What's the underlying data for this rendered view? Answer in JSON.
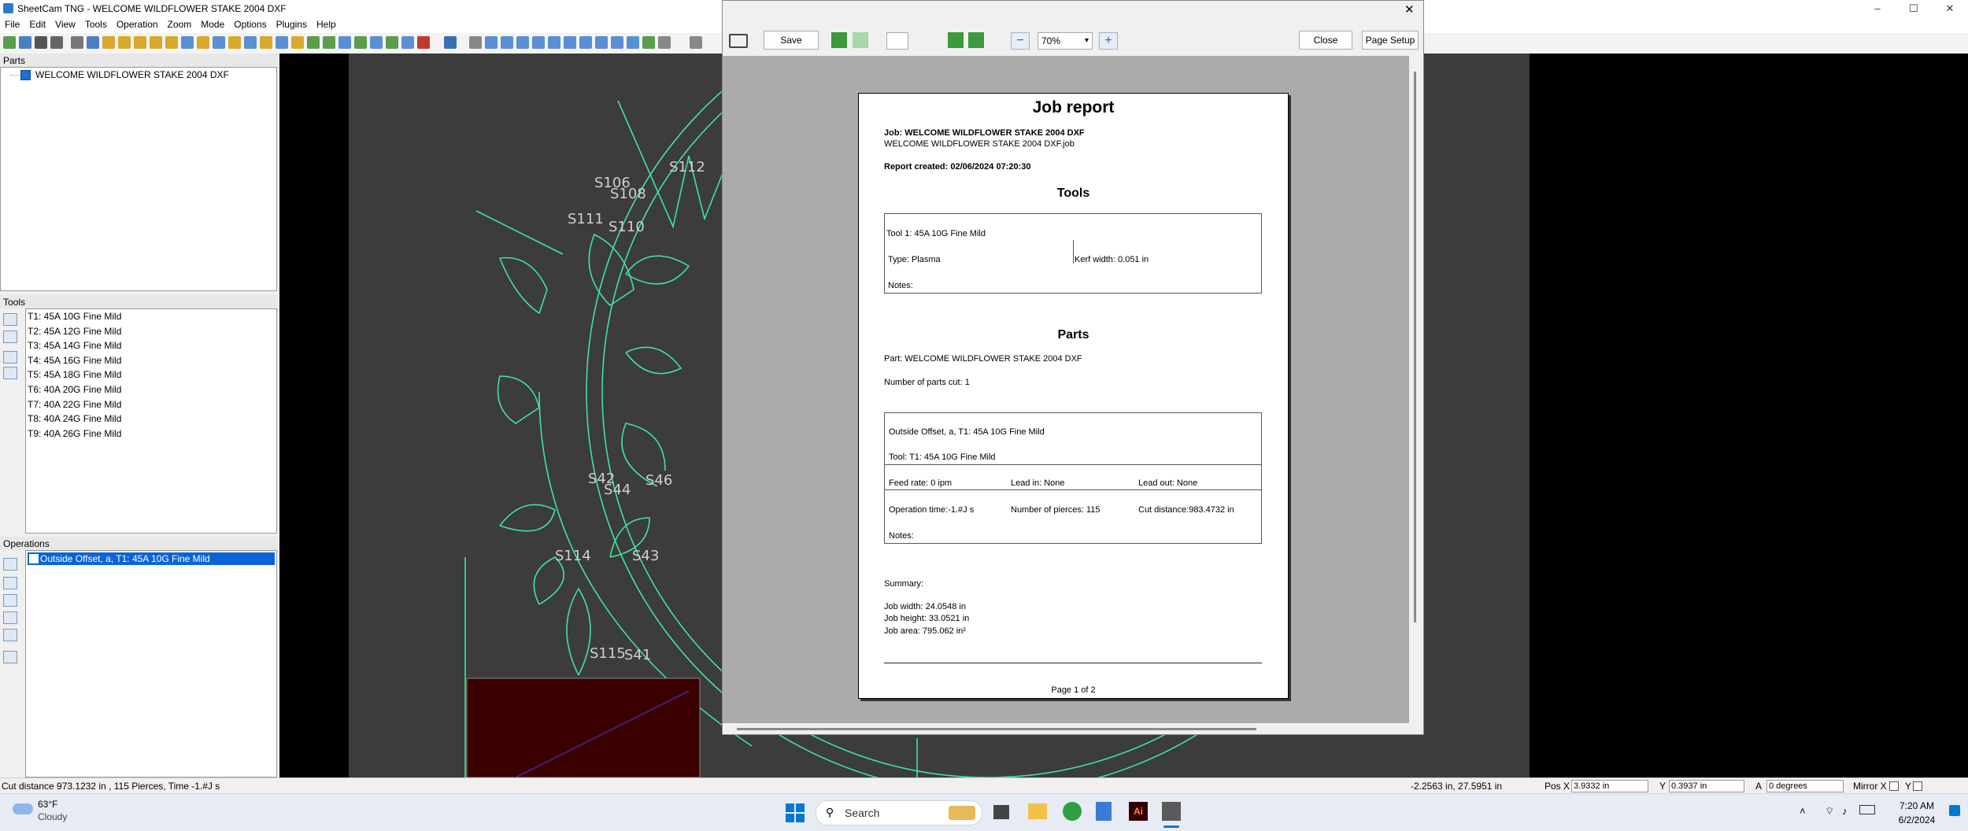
{
  "window": {
    "title": "SheetCam TNG - WELCOME WILDFLOWER STAKE 2004 DXF",
    "minimize": "–",
    "maximize": "☐",
    "close": "✕"
  },
  "menu": [
    "File",
    "Edit",
    "View",
    "Tools",
    "Operation",
    "Zoom",
    "Mode",
    "Options",
    "Plugins",
    "Help"
  ],
  "parts_panel": {
    "header": "Parts",
    "item": "WELCOME WILDFLOWER STAKE 2004 DXF"
  },
  "tools_panel": {
    "header": "Tools",
    "items": [
      "T1: 45A 10G Fine Mild",
      "T2: 45A 12G Fine Mild",
      "T3: 45A 14G Fine Mild",
      "T4: 45A 16G Fine Mild",
      "T5: 45A 18G Fine Mild",
      "T6: 40A 20G Fine Mild",
      "T7: 40A 22G Fine Mild",
      "T8: 40A 24G Fine Mild",
      "T9: 40A 26G Fine Mild"
    ]
  },
  "operations_panel": {
    "header": "Operations",
    "item": "Outside Offset, a, T1: 45A 10G Fine Mild"
  },
  "canvas_labels": [
    "S106",
    "S108",
    "S112",
    "S111",
    "S110",
    "S42",
    "S44",
    "S46",
    "S114",
    "S43",
    "S115",
    "S41"
  ],
  "dialog": {
    "close_x": "✕",
    "save": "Save",
    "zoom": "70%",
    "zoom_minus": "−",
    "zoom_plus": "+",
    "close": "Close",
    "page_setup": "Page Setup"
  },
  "report": {
    "title": "Job report",
    "job_label": "Job: WELCOME WILDFLOWER STAKE 2004 DXF",
    "job_file": "WELCOME WILDFLOWER STAKE 2004 DXF.job",
    "created": "Report created: 02/06/2024 07:20:30",
    "tools_heading": "Tools",
    "tool_name": "Tool 1: 45A 10G Fine Mild",
    "tool_type": "Type: Plasma",
    "kerf": "Kerf width: 0.051 in",
    "tool_notes": "Notes:",
    "parts_heading": "Parts",
    "part": "Part: WELCOME WILDFLOWER STAKE 2004 DXF",
    "parts_cut": "Number of parts cut: 1",
    "op_name": "Outside Offset, a, T1: 45A 10G Fine Mild",
    "op_tool": "Tool: T1: 45A 10G Fine Mild",
    "feed": "Feed rate: 0 ipm",
    "lead_in": "Lead in: None",
    "lead_out": "Lead out: None",
    "op_time": "Operation time:-1.#J s",
    "pierces": "Number of pierces: 115",
    "cut_dist": "Cut distance:983.4732 in",
    "op_notes": "Notes:",
    "summary": "Summary:",
    "job_width": "Job width: 24.0548 in",
    "job_height": "Job height: 33.0521 in",
    "job_area": "Job area: 795.062 in²",
    "page": "Page 1 of 2"
  },
  "status": {
    "left": "Cut distance 973.1232 in , 115 Pierces, Time -1.#J s",
    "coords": "-2.2563 in, 27.5951 in",
    "pos_x_label": "Pos X",
    "pos_x": "3.9332 in",
    "y_label": "Y",
    "y": "0.3937 in",
    "a_label": "A",
    "a": "0 degrees",
    "mirror_x": "Mirror X",
    "mirror_y": "Y"
  },
  "taskbar": {
    "temp": "63°F",
    "weather": "Cloudy",
    "search": "Search",
    "time": "7:20 AM",
    "date": "6/2/2024"
  },
  "colors": {
    "outline": "#3fe3a0",
    "selection": "#0a64d8",
    "canvas_bg": "#000000",
    "sheet_bg": "#3c3c3c"
  }
}
